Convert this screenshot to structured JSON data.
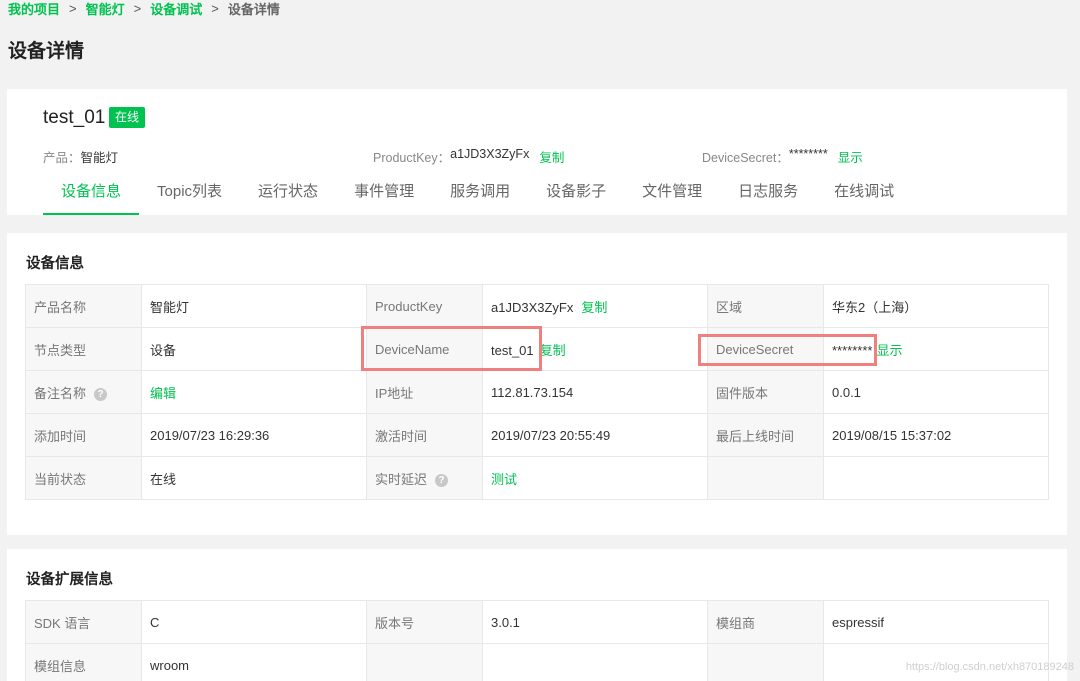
{
  "breadcrumb": {
    "items": [
      "我的项目",
      "智能灯",
      "设备调试"
    ],
    "current": "设备详情",
    "separator": ">"
  },
  "page_title": "设备详情",
  "header": {
    "device_name": "test_01",
    "status_badge": "在线",
    "product_label": "产品：",
    "product_value": "智能灯",
    "productkey_label": "ProductKey：",
    "productkey_value": "a1JD3X3ZyFx",
    "copy_label": "复制",
    "devicesecret_label": "DeviceSecret：",
    "devicesecret_value": "********",
    "show_label": "显示"
  },
  "tabs": [
    {
      "label": "设备信息",
      "active": true
    },
    {
      "label": "Topic列表"
    },
    {
      "label": "运行状态"
    },
    {
      "label": "事件管理"
    },
    {
      "label": "服务调用"
    },
    {
      "label": "设备影子"
    },
    {
      "label": "文件管理"
    },
    {
      "label": "日志服务"
    },
    {
      "label": "在线调试"
    }
  ],
  "device_info": {
    "title": "设备信息",
    "rows": [
      [
        {
          "k": "产品名称",
          "v": "智能灯"
        },
        {
          "k": "ProductKey",
          "v": "a1JD3X3ZyFx",
          "action": "复制"
        },
        {
          "k": "区域",
          "v": "华东2（上海）"
        }
      ],
      [
        {
          "k": "节点类型",
          "v": "设备"
        },
        {
          "k": "DeviceName",
          "v": "test_01",
          "action": "复制"
        },
        {
          "k": "DeviceSecret",
          "v": "********",
          "action": "显示"
        }
      ],
      [
        {
          "k": "备注名称",
          "help": "?",
          "link": "编辑"
        },
        {
          "k": "IP地址",
          "v": "112.81.73.154"
        },
        {
          "k": "固件版本",
          "v": "0.0.1"
        }
      ],
      [
        {
          "k": "添加时间",
          "v": "2019/07/23 16:29:36"
        },
        {
          "k": "激活时间",
          "v": "2019/07/23 20:55:49"
        },
        {
          "k": "最后上线时间",
          "v": "2019/08/15 15:37:02"
        }
      ],
      [
        {
          "k": "当前状态",
          "v": "在线"
        },
        {
          "k": "实时延迟",
          "help": "?",
          "link": "测试"
        },
        {
          "k": "",
          "v": ""
        }
      ]
    ]
  },
  "ext_info": {
    "title": "设备扩展信息",
    "rows": [
      [
        {
          "k": "SDK 语言",
          "v": "C"
        },
        {
          "k": "版本号",
          "v": "3.0.1"
        },
        {
          "k": "模组商",
          "v": "espressif"
        }
      ],
      [
        {
          "k": "模组信息",
          "v": "wroom"
        },
        {
          "k": "",
          "v": ""
        },
        {
          "k": "",
          "v": ""
        }
      ]
    ]
  },
  "watermark": "https://blog.csdn.net/xh870189248",
  "colors": {
    "accent": "#00c250",
    "highlight": "#f08080"
  }
}
